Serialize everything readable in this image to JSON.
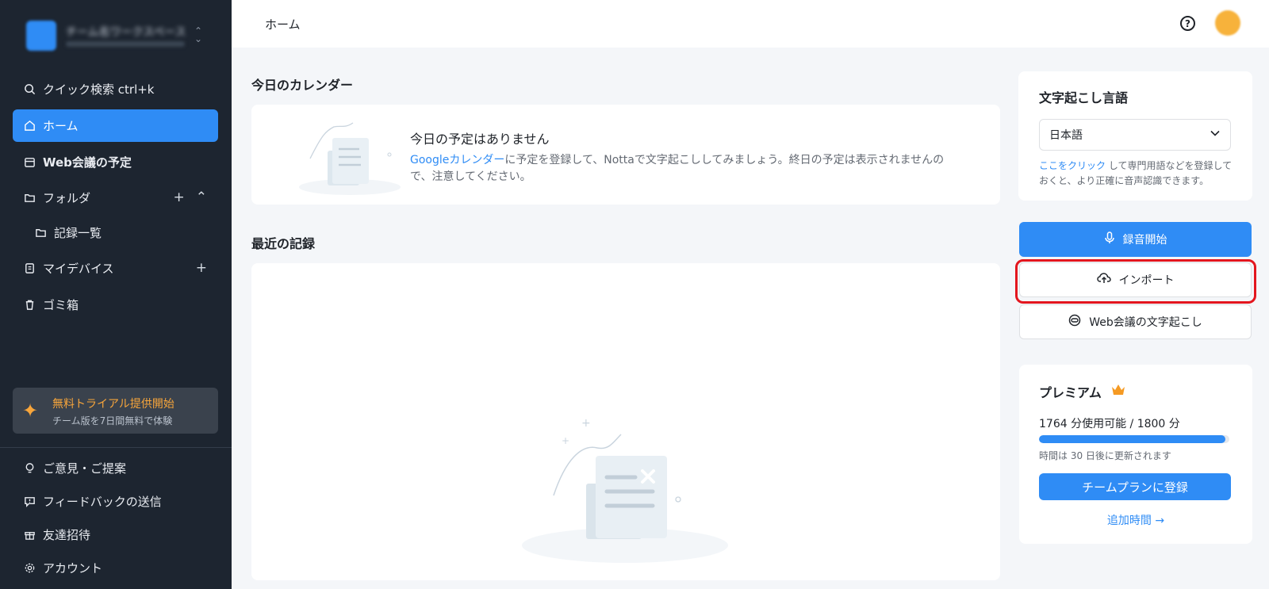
{
  "sidebar": {
    "workspace_name": "チーム名ワークスペース",
    "nav": [
      {
        "label": "クイック検索 ctrl+k",
        "icon": "search-icon"
      },
      {
        "label": "ホーム",
        "icon": "home-icon"
      },
      {
        "label": "Web会議の予定",
        "icon": "calendar-icon"
      },
      {
        "label": "フォルダ",
        "icon": "folder-icon"
      },
      {
        "label": "記録一覧",
        "icon": "folder-icon"
      },
      {
        "label": "マイデバイス",
        "icon": "device-icon"
      },
      {
        "label": "ゴミ箱",
        "icon": "trash-icon"
      }
    ],
    "trial": {
      "title": "無料トライアル提供開始",
      "subtitle": "チーム版を7日間無料で体験"
    },
    "bottom": [
      {
        "label": "ご意見・ご提案",
        "icon": "lightbulb-icon"
      },
      {
        "label": "フィードバックの送信",
        "icon": "feedback-icon"
      },
      {
        "label": "友達招待",
        "icon": "gift-icon"
      },
      {
        "label": "アカウント",
        "icon": "gear-icon"
      }
    ]
  },
  "header": {
    "breadcrumb": "ホーム"
  },
  "calendar": {
    "section_title": "今日のカレンダー",
    "empty_title": "今日の予定はありません",
    "desc_link": "Googleカレンダー",
    "desc_rest": "に予定を登録して、Nottaで文字起こししてみましょう。終日の予定は表示されませんので、注意してください。"
  },
  "recent": {
    "section_title": "最近の記録"
  },
  "language": {
    "title": "文字起こし言語",
    "selected": "日本語",
    "note_link": "ここをクリック",
    "note_rest": " して専門用語などを登録しておくと、より正確に音声認識できます。"
  },
  "actions": {
    "record": "録音開始",
    "import": "インポート",
    "web_meeting": "Web会議の文字起こし"
  },
  "premium": {
    "title": "プレミアム",
    "usage": "1764 分使用可能 / 1800 分",
    "usage_fraction": 0.98,
    "renew_note": "時間は 30 日後に更新されます",
    "team_button": "チームプランに登録",
    "extra_time": "追加時間 →"
  },
  "colors": {
    "accent": "#2f8cf5",
    "sidebar_bg": "#1d2530",
    "trial_accent": "#f7a53b",
    "highlight": "#e3161e"
  }
}
